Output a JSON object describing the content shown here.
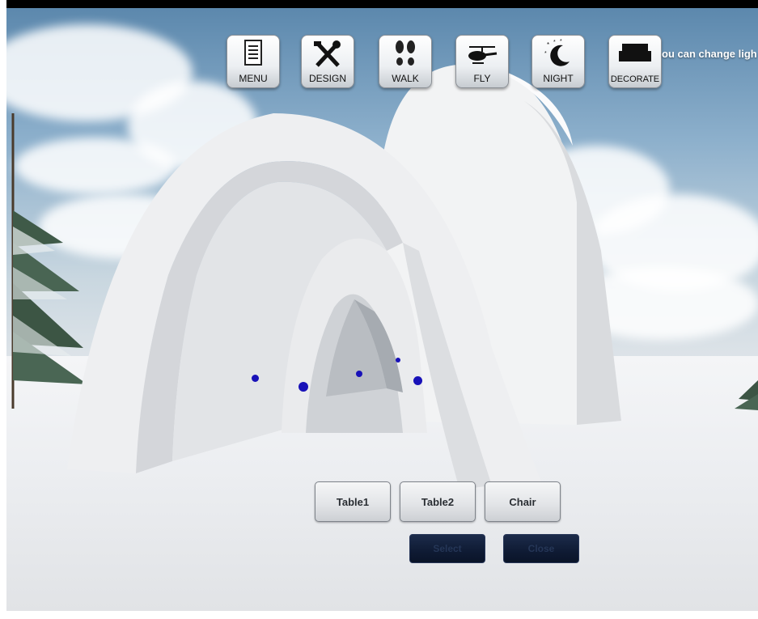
{
  "toolbar": {
    "menu_label": "MENU",
    "design_label": "DESIGN",
    "walk_label": "WALK",
    "fly_label": "FLY",
    "night_label": "NIGHT",
    "decorate_label": "DECORATE"
  },
  "hint_text": "ou can change ligh",
  "furniture": {
    "table1_label": "Table1",
    "table2_label": "Table2",
    "chair_label": "Chair"
  },
  "actions": {
    "select_label": "Select",
    "close_label": "Close"
  },
  "colors": {
    "marker": "#1811b8",
    "action_button": "#0f1b34",
    "hint_text": "#ffffff"
  },
  "icons": [
    "document-list-icon",
    "tools-icon",
    "footprints-icon",
    "helicopter-icon",
    "night-moon-icon",
    "sofa-icon"
  ]
}
